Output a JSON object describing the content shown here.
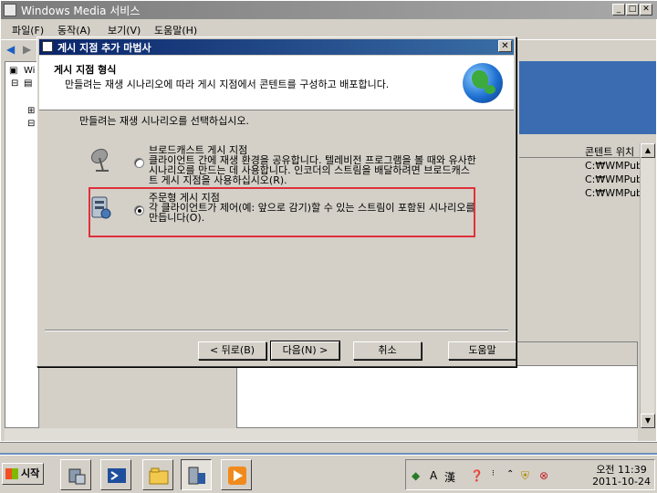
{
  "window": {
    "title": "Windows Media 서비스",
    "controls": [
      "_",
      "□",
      "✕"
    ]
  },
  "menu": [
    {
      "label": "파일(F)"
    },
    {
      "label": "동작(A)"
    },
    {
      "label": "보기(V)"
    },
    {
      "label": "도움말(H)"
    }
  ],
  "tree": {
    "item0": "Wi"
  },
  "list": {
    "column_header": "콘텐트 위치",
    "rows": [
      "C:₩WMPub",
      "C:₩WMPub",
      "C:₩WMPub"
    ]
  },
  "dialog": {
    "title": "게시 지점 추가 마법사",
    "close": "✕",
    "header_title": "게시 지점 형식",
    "header_subtitle": "만들려는 재생 시나리오에 따라 게시 지점에서 콘텐트를 구성하고 배포합니다.",
    "prompt": "만들려는 재생 시나리오를 선택하십시오.",
    "options": [
      {
        "text": "브로드캐스트 게시 지점\n클라이언트 간에 재생 환경을 공유합니다. 텔레비전 프로그램을 볼 때와 유사한 시나리오를 만드는 데 사용합니다. 인코더의 스트림을 배달하려면 브로드캐스트 게시 지점을 사용하십시오(R).",
        "selected": false,
        "icon": "satellite-dish-icon"
      },
      {
        "text": "주문형 게시 지점\n각 클라이언트가 제어(예: 앞으로 감기)할 수 있는 스트림이 포함된 시나리오를 만듭니다(O).",
        "selected": true,
        "icon": "server-icon"
      }
    ],
    "buttons": {
      "back": "< 뒤로(B)",
      "next": "다음(N) >",
      "cancel": "취소",
      "help": "도움말"
    }
  },
  "taskbar": {
    "start": "시작",
    "apps": [
      "server-manager-icon",
      "powershell-icon",
      "explorer-icon",
      "windows-media-services-icon",
      "media-player-icon"
    ],
    "tray": {
      "ime_a": "A",
      "ime_han": "漢",
      "clock_time": "오전 11:39",
      "clock_date": "2011-10-24"
    }
  },
  "colors": {
    "highlight_border": "#e0303a",
    "dialog_title": "#0a246a"
  }
}
